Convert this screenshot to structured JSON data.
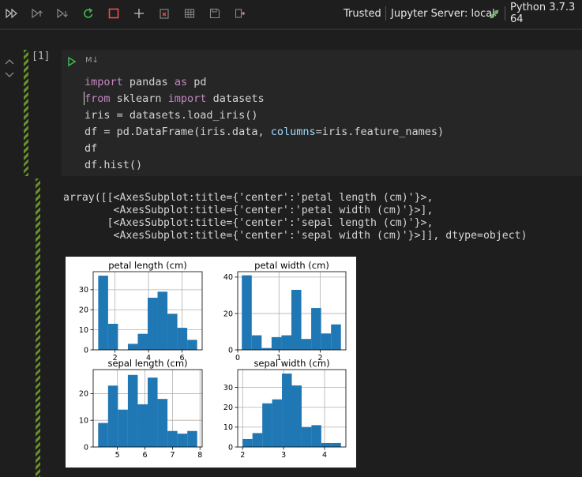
{
  "toolbar": {
    "icons": [
      "run-all-icon",
      "run-above-icon",
      "run-below-icon",
      "restart-icon",
      "interrupt-icon",
      "add-cell-icon",
      "clear-outputs-icon",
      "variables-icon",
      "save-icon",
      "export-icon"
    ],
    "trusted": "Trusted",
    "server": "Jupyter Server: local",
    "kernel": "Python 3.7.3 64",
    "colors": {
      "restart": "#3fb950",
      "interrupt": "#f14c4c",
      "server_icon": "#89d185"
    }
  },
  "cell": {
    "exec_count": "[1]",
    "cell_type_label": "M↓",
    "code_lines": [
      [
        {
          "t": "import",
          "c": "kw"
        },
        {
          "t": " pandas "
        },
        {
          "t": "as",
          "c": "kw"
        },
        {
          "t": " pd"
        }
      ],
      [
        {
          "t": "from",
          "c": "kw"
        },
        {
          "t": " sklearn "
        },
        {
          "t": "import",
          "c": "kw"
        },
        {
          "t": " datasets"
        }
      ],
      [
        {
          "t": "iris = datasets.load_iris()"
        }
      ],
      [
        {
          "t": "df = pd.DataFrame(iris.data, "
        },
        {
          "t": "columns",
          "c": "kwarg"
        },
        {
          "t": "=iris.feature_names)"
        }
      ],
      [
        {
          "t": "df"
        }
      ],
      [
        {
          "t": "df.hist()"
        }
      ]
    ]
  },
  "output": {
    "lines": [
      "array([[<AxesSubplot:title={'center':'petal length (cm)'}>,",
      "        <AxesSubplot:title={'center':'petal width (cm)'}>],",
      "       [<AxesSubplot:title={'center':'sepal length (cm)'}>,",
      "        <AxesSubplot:title={'center':'sepal width (cm)'}>]], dtype=object)"
    ]
  },
  "chart_data": [
    {
      "type": "bar",
      "title": "petal length (cm)",
      "bar_color": "#1f77b4",
      "grid": true,
      "bin_edges": [
        1.0,
        1.59,
        2.18,
        2.77,
        3.36,
        3.95,
        4.54,
        5.13,
        5.72,
        6.31,
        6.9
      ],
      "values": [
        37,
        13,
        0,
        3,
        8,
        26,
        29,
        18,
        11,
        5
      ],
      "xlim": [
        0.7,
        7.2
      ],
      "ylim": [
        0,
        39
      ],
      "xticks": [
        2,
        4,
        6
      ],
      "yticks": [
        0,
        10,
        20,
        30
      ]
    },
    {
      "type": "bar",
      "title": "petal width (cm)",
      "bar_color": "#1f77b4",
      "grid": true,
      "bin_edges": [
        0.1,
        0.34,
        0.58,
        0.82,
        1.06,
        1.3,
        1.54,
        1.78,
        2.02,
        2.26,
        2.5
      ],
      "values": [
        41,
        8,
        1,
        7,
        8,
        33,
        6,
        23,
        9,
        14
      ],
      "xlim": [
        0.0,
        2.62
      ],
      "ylim": [
        0,
        43
      ],
      "xticks": [
        0,
        1,
        2
      ],
      "yticks": [
        0,
        20,
        40
      ]
    },
    {
      "type": "bar",
      "title": "sepal length (cm)",
      "bar_color": "#1f77b4",
      "grid": true,
      "bin_edges": [
        4.3,
        4.66,
        5.02,
        5.38,
        5.74,
        6.1,
        6.46,
        6.82,
        7.18,
        7.54,
        7.9
      ],
      "values": [
        9,
        23,
        14,
        27,
        16,
        26,
        18,
        6,
        5,
        6
      ],
      "xlim": [
        4.12,
        8.08
      ],
      "ylim": [
        0,
        29
      ],
      "xticks": [
        5,
        6,
        7,
        8
      ],
      "yticks": [
        0,
        10,
        20
      ]
    },
    {
      "type": "bar",
      "title": "sepal width (cm)",
      "bar_color": "#1f77b4",
      "grid": true,
      "bin_edges": [
        2.0,
        2.24,
        2.48,
        2.72,
        2.96,
        3.2,
        3.44,
        3.68,
        3.92,
        4.16,
        4.4
      ],
      "values": [
        4,
        7,
        22,
        24,
        37,
        31,
        10,
        11,
        2,
        2
      ],
      "xlim": [
        1.88,
        4.52
      ],
      "ylim": [
        0,
        39
      ],
      "xticks": [
        2,
        3,
        4
      ],
      "yticks": [
        0,
        10,
        20,
        30
      ]
    }
  ]
}
